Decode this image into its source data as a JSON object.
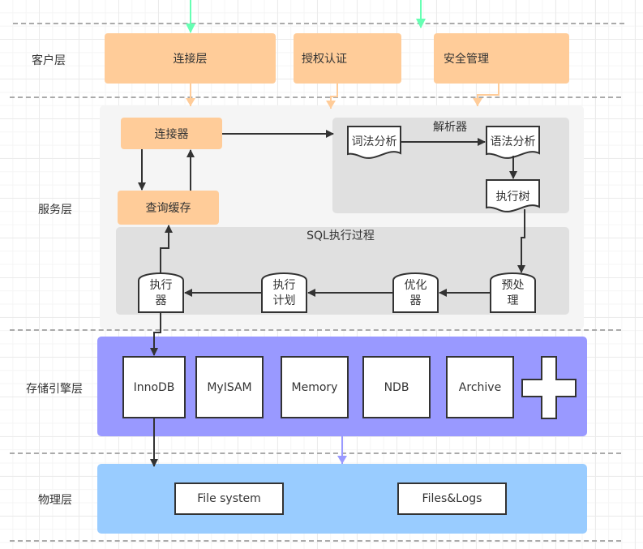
{
  "layers": {
    "client": "客户层",
    "service": "服务层",
    "storage": "存储引擎层",
    "physical": "物理层"
  },
  "client_layer": {
    "connection": "连接层",
    "auth": "授权认证",
    "security": "安全管理"
  },
  "service_layer": {
    "connector": "连接器",
    "query_cache": "查询缓存",
    "parser_group": {
      "title": "解析器",
      "lexical": "词法分析",
      "syntax": "语法分析",
      "exec_tree": "执行树"
    },
    "sql_group": {
      "title": "SQL执行过程",
      "preprocess": [
        "预处",
        "理"
      ],
      "optimizer": [
        "优化",
        "器"
      ],
      "exec_plan": [
        "执行",
        "计划"
      ],
      "executor": [
        "执行",
        "器"
      ]
    }
  },
  "storage_layer": {
    "engines": [
      "InnoDB",
      "MyISAM",
      "Memory",
      "NDB",
      "Archive"
    ],
    "more_icon": "plus-icon"
  },
  "physical_layer": {
    "items": [
      "File system",
      "Files&Logs"
    ]
  },
  "colors": {
    "orange": "#ffcc99",
    "service_bg": "#f5f5f5",
    "group_bg": "#e0e0e0",
    "storage_bg": "#9999ff",
    "physical_bg": "#99ccff",
    "green_arrow": "#66ffb3",
    "stroke": "#333333"
  }
}
